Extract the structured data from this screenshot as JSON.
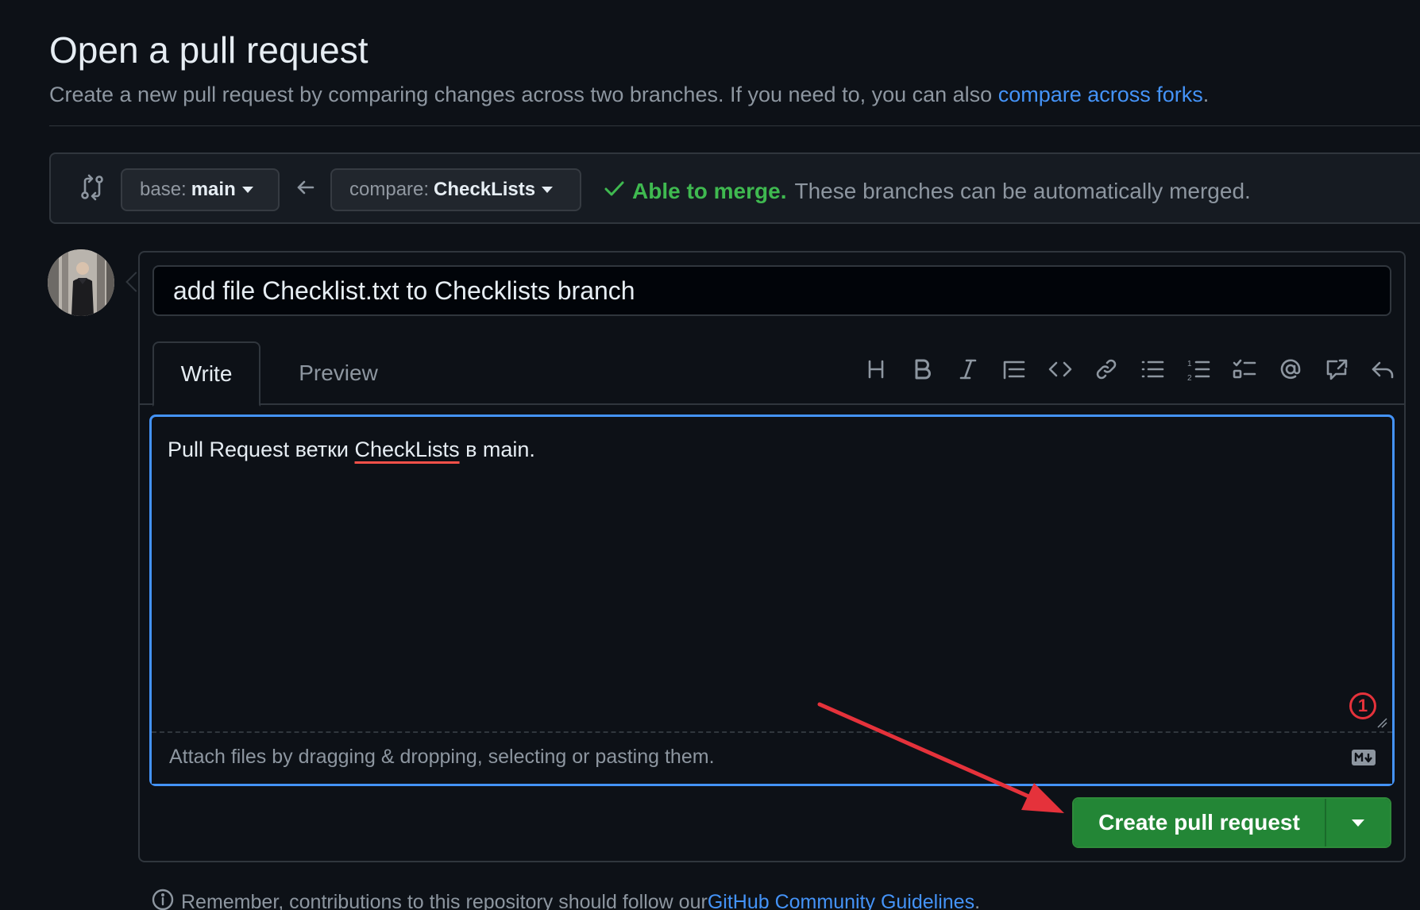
{
  "page": {
    "title": "Open a pull request",
    "subtitle": "Create a new pull request by comparing changes across two branches. If you need to, you can also ",
    "subtitle_link": "compare across forks",
    "subtitle_end": "."
  },
  "compare": {
    "base_prefix": "base:",
    "base_value": "main",
    "compare_prefix": "compare:",
    "compare_value": "CheckLists",
    "merge_ok": "Able to merge.",
    "merge_msg": "These branches can be automatically merged."
  },
  "form": {
    "title_value": "add file Checklist.txt to Checklists branch",
    "tabs": [
      {
        "label": "Write",
        "active": true
      },
      {
        "label": "Preview",
        "active": false
      }
    ],
    "toolbar_icons": [
      "heading-icon",
      "bold-icon",
      "italic-icon",
      "quote-icon",
      "code-icon",
      "link-icon",
      "unordered-list-icon",
      "ordered-list-icon",
      "task-list-icon",
      "mention-icon",
      "cross-reference-icon",
      "reply-icon"
    ],
    "body_before": "Pull Request ветки ",
    "body_misspelled": "CheckLists",
    "body_after": " в main.",
    "attach_hint": "Attach files by dragging & dropping, selecting or pasting them.",
    "submit_label": "Create pull request"
  },
  "annotation": {
    "step_number": "1",
    "color": "#e5323b"
  },
  "footer": {
    "note": "Remember, contributions to this repository should follow our ",
    "link": "GitHub Community Guidelines",
    "end": "."
  },
  "colors": {
    "background": "#0d1117",
    "accent": "#4493f8",
    "success": "#3fb950",
    "button_green": "#238636",
    "muted_text": "#8d96a0"
  }
}
